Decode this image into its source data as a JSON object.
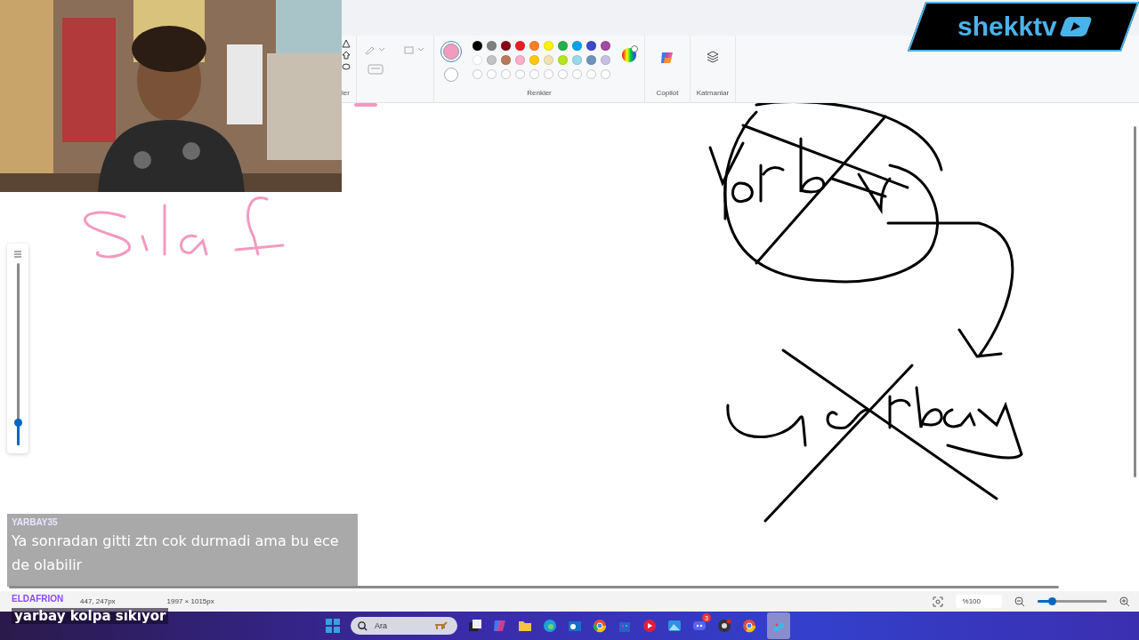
{
  "ribbon": {
    "cut_group_label": "ler",
    "colors": {
      "label": "Renkler",
      "primary": {
        "color": "#f29ac0"
      },
      "secondary": {
        "color": "#ffffff"
      },
      "swatches": [
        {
          "color": "#000000"
        },
        {
          "color": "#7f7f7f"
        },
        {
          "color": "#880015"
        },
        {
          "color": "#ed1c24"
        },
        {
          "color": "#ff7f27"
        },
        {
          "color": "#fff200"
        },
        {
          "color": "#22b14c"
        },
        {
          "color": "#00a2e8"
        },
        {
          "color": "#3f48cc"
        },
        {
          "color": "#a349a4"
        },
        {
          "color": "#ffffff"
        },
        {
          "color": "#c3c3c3"
        },
        {
          "color": "#b97a57"
        },
        {
          "color": "#ffaec9"
        },
        {
          "color": "#ffc90e"
        },
        {
          "color": "#efe4b0"
        },
        {
          "color": "#b5e61d"
        },
        {
          "color": "#99d9ea"
        },
        {
          "color": "#7092be"
        },
        {
          "color": "#c8bfe7"
        }
      ]
    },
    "copilot_label": "Copilot",
    "layers_label": "Katmanlar"
  },
  "brush_size": {
    "level": 0.12
  },
  "logo": {
    "text": "shekktv"
  },
  "chat": [
    {
      "user": "YARBAY35",
      "message": "Ya sonradan gitti ztn cok durmadi ama bu ece de olabilir"
    },
    {
      "user": "ELDAFRION",
      "message": "yarbay kolpa sıkıyor"
    }
  ],
  "status_bar": {
    "cursor": "447, 247px",
    "canvas_size": "1997 × 1015px",
    "zoom": "%100",
    "zoom_slider": {
      "level": 0.2
    }
  },
  "taskbar": {
    "search_placeholder": "Ara",
    "discord_badge": "3"
  }
}
